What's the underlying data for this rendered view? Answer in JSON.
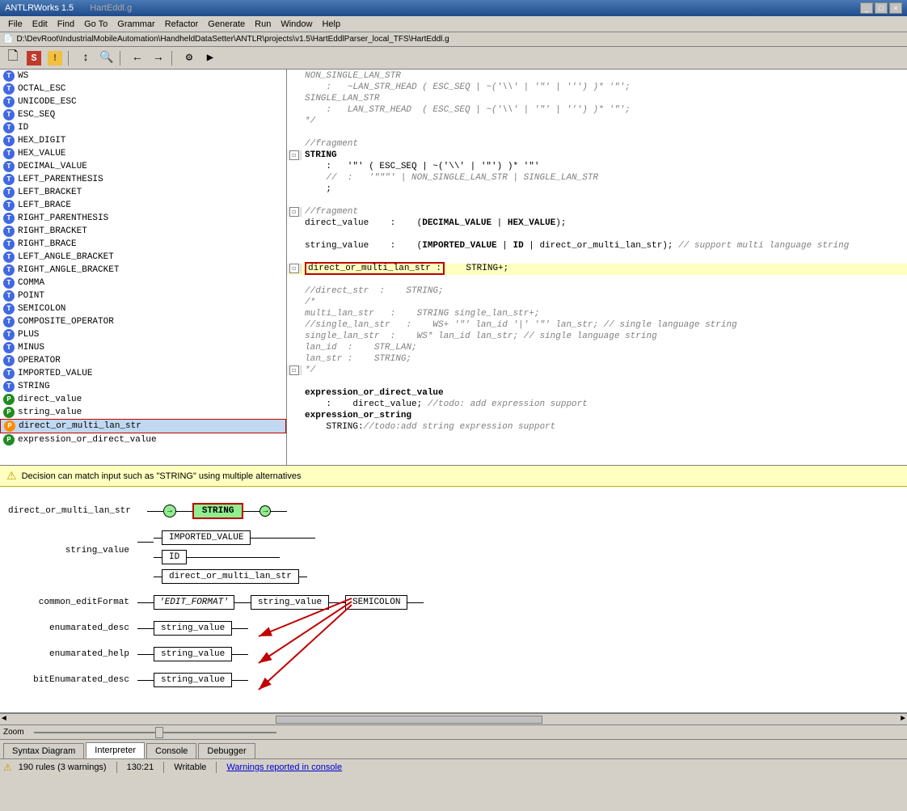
{
  "window": {
    "title": "ANTLRWorks 1.5",
    "filepath": "D:\\DevRoot\\IndustrialMobileAutomation\\HandheldDataSetter\\ANTLR\\projects\\v1.5\\HartEddlParser_local_TFS\\HartEddl.g"
  },
  "menu": {
    "items": [
      "File",
      "Edit",
      "Find",
      "Go To",
      "Grammar",
      "Refactor",
      "Generate",
      "Run",
      "Window",
      "Help"
    ]
  },
  "toolbar": {
    "buttons": [
      "save",
      "s-button",
      "warning",
      "sep",
      "sort",
      "find",
      "sep",
      "generate",
      "run",
      "sep",
      "back",
      "forward",
      "sep",
      "debug",
      "step"
    ]
  },
  "tree": {
    "items": [
      {
        "label": "WS",
        "icon": "blue",
        "type": "T"
      },
      {
        "label": "OCTAL_ESC",
        "icon": "blue",
        "type": "T"
      },
      {
        "label": "UNICODE_ESC",
        "icon": "blue",
        "type": "T"
      },
      {
        "label": "ESC_SEQ",
        "icon": "blue",
        "type": "T"
      },
      {
        "label": "ID",
        "icon": "blue",
        "type": "T"
      },
      {
        "label": "HEX_DIGIT",
        "icon": "blue",
        "type": "T"
      },
      {
        "label": "HEX_VALUE",
        "icon": "blue",
        "type": "T"
      },
      {
        "label": "DECIMAL_VALUE",
        "icon": "blue",
        "type": "T"
      },
      {
        "label": "LEFT_PARENTHESIS",
        "icon": "blue",
        "type": "T"
      },
      {
        "label": "LEFT_BRACKET",
        "icon": "blue",
        "type": "T"
      },
      {
        "label": "LEFT_BRACE",
        "icon": "blue",
        "type": "T"
      },
      {
        "label": "RIGHT_PARENTHESIS",
        "icon": "blue",
        "type": "T"
      },
      {
        "label": "RIGHT_BRACKET",
        "icon": "blue",
        "type": "T"
      },
      {
        "label": "RIGHT_BRACE",
        "icon": "blue",
        "type": "T"
      },
      {
        "label": "LEFT_ANGLE_BRACKET",
        "icon": "blue",
        "type": "T"
      },
      {
        "label": "RIGHT_ANGLE_BRACKET",
        "icon": "blue",
        "type": "T"
      },
      {
        "label": "COMMA",
        "icon": "blue",
        "type": "T"
      },
      {
        "label": "POINT",
        "icon": "blue",
        "type": "T"
      },
      {
        "label": "SEMICOLON",
        "icon": "blue",
        "type": "T"
      },
      {
        "label": "COMPOSITE_OPERATOR",
        "icon": "blue",
        "type": "T"
      },
      {
        "label": "PLUS",
        "icon": "blue",
        "type": "T"
      },
      {
        "label": "MINUS",
        "icon": "blue",
        "type": "T"
      },
      {
        "label": "OPERATOR",
        "icon": "blue",
        "type": "T"
      },
      {
        "label": "IMPORTED_VALUE",
        "icon": "blue",
        "type": "T"
      },
      {
        "label": "STRING",
        "icon": "blue",
        "type": "T"
      },
      {
        "label": "direct_value",
        "icon": "green",
        "type": "P"
      },
      {
        "label": "string_value",
        "icon": "green",
        "type": "P"
      },
      {
        "label": "direct_or_multi_lan_str",
        "icon": "orange",
        "type": "P",
        "selected": true
      },
      {
        "label": "expression_or_direct_value",
        "icon": "green",
        "type": "P"
      }
    ]
  },
  "code": {
    "lines": [
      {
        "gutter": "",
        "content": "NON_SINGLE_LAN_STR",
        "style": "normal"
      },
      {
        "gutter": "",
        "content": "    :   ~LAN_STR_HEAD ( ESC_SEQ | ~('\\\\''\"''') )* '\"';",
        "style": "comment"
      },
      {
        "gutter": "",
        "content": "SINGLE_LAN_STR",
        "style": "normal"
      },
      {
        "gutter": "",
        "content": "    :   LAN_STR_HEAD  ( ESC_SEQ | ~('\\\\''\"''') )* '\"';",
        "style": "comment"
      },
      {
        "gutter": "",
        "content": "*/",
        "style": "comment"
      },
      {
        "gutter": "",
        "content": "",
        "style": "normal"
      },
      {
        "gutter": "",
        "content": "//fragment",
        "style": "comment"
      },
      {
        "gutter": "◻",
        "content": "STRING",
        "style": "bold"
      },
      {
        "gutter": "",
        "content": "    :   '\"' ( ESC_SEQ | ~('\\\\' | '\"') )* '\"'",
        "style": "normal"
      },
      {
        "gutter": "",
        "content": "    //  :   '\"\"\"' | NON_SINGLE_LAN_STR | SINGLE_LAN_STR",
        "style": "comment"
      },
      {
        "gutter": "",
        "content": "    ;",
        "style": "normal"
      },
      {
        "gutter": "",
        "content": "",
        "style": "normal"
      },
      {
        "gutter": "◻",
        "content": "//fragment",
        "style": "comment"
      },
      {
        "gutter": "",
        "content": "direct_value    :    (DECIMAL_VALUE | HEX_VALUE);",
        "style": "normal"
      },
      {
        "gutter": "",
        "content": "",
        "style": "normal"
      },
      {
        "gutter": "",
        "content": "string_value    :    (IMPORTED_VALUE | ID | direct_or_multi_lan_str); // support multi language string",
        "style": "normal"
      },
      {
        "gutter": "",
        "content": "",
        "style": "normal"
      },
      {
        "gutter": "◻",
        "content": "direct_or_multi_lan_str :    STRING+;",
        "style": "highlighted"
      },
      {
        "gutter": "",
        "content": "",
        "style": "normal"
      },
      {
        "gutter": "",
        "content": "//direct_str  :    STRING;",
        "style": "comment"
      },
      {
        "gutter": "",
        "content": "/*",
        "style": "comment"
      },
      {
        "gutter": "",
        "content": "multi_lan_str   :    STRING single_lan_str+;",
        "style": "comment"
      },
      {
        "gutter": "",
        "content": "//single_lan_str   :    WS+ '\"' lan_id '|' '\"' lan_str; // single language string",
        "style": "comment"
      },
      {
        "gutter": "",
        "content": "single_lan_str  :    WS* lan_id lan_str; // single language string",
        "style": "comment"
      },
      {
        "gutter": "",
        "content": "lan_id  :    STR_LAN;",
        "style": "comment"
      },
      {
        "gutter": "",
        "content": "lan_str :    STRING;",
        "style": "comment"
      },
      {
        "gutter": "◻",
        "content": "*/",
        "style": "comment"
      },
      {
        "gutter": "",
        "content": "",
        "style": "normal"
      },
      {
        "gutter": "",
        "content": "expression_or_direct_value",
        "style": "bold"
      },
      {
        "gutter": "",
        "content": "    :    direct_value; //todo: add expression support",
        "style": "normal"
      },
      {
        "gutter": "",
        "content": "expression_or_string",
        "style": "bold"
      },
      {
        "gutter": "",
        "content": "    STRING://todo:add string expression support",
        "style": "normal"
      }
    ]
  },
  "warning": {
    "text": "Decision can match input such as \"STRING\" using multiple alternatives"
  },
  "diagram": {
    "rules": [
      {
        "name": "direct_or_multi_lan_str",
        "flow": "STRING+"
      },
      {
        "name": "string_value",
        "alternatives": [
          "IMPORTED_VALUE",
          "ID",
          "direct_or_multi_lan_str"
        ]
      },
      {
        "name": "common_editFormat",
        "flow": [
          "'EDIT_FORMAT'",
          "string_value",
          "SEMICOLON"
        ]
      },
      {
        "name": "enumarated_desc",
        "flow": [
          "string_value"
        ]
      },
      {
        "name": "enumarated_help",
        "flow": [
          "string_value"
        ]
      },
      {
        "name": "bitEnumarated_desc",
        "flow": [
          "string_value"
        ]
      }
    ]
  },
  "zoom": {
    "label": "Zoom",
    "value": 50
  },
  "tabs": [
    {
      "label": "Syntax Diagram",
      "active": false
    },
    {
      "label": "Interpreter",
      "active": true
    },
    {
      "label": "Console",
      "active": false
    },
    {
      "label": "Debugger",
      "active": false
    }
  ],
  "statusbar": {
    "rules_count": "190 rules (3 warnings)",
    "position": "130:21",
    "mode": "Writable",
    "warning_link": "Warnings reported in console"
  }
}
